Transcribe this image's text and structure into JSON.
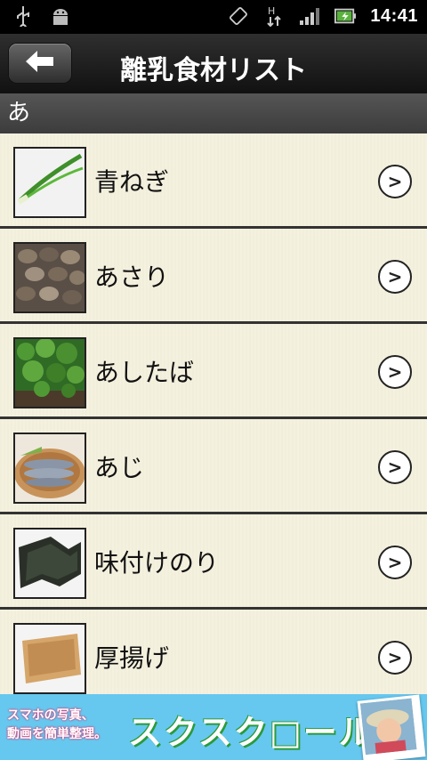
{
  "status_bar": {
    "time": "14:41",
    "icons": [
      "usb-icon",
      "android-debug-icon",
      "rotate-icon",
      "data-transfer-icon",
      "signal-icon",
      "battery-icon"
    ]
  },
  "header": {
    "title": "離乳食材リスト",
    "back_icon": "back-arrow-icon"
  },
  "section": {
    "label": "あ"
  },
  "items": [
    {
      "label": "青ねぎ",
      "icon": "green-onion-thumbnail"
    },
    {
      "label": "あさり",
      "icon": "clams-thumbnail"
    },
    {
      "label": "あしたば",
      "icon": "ashitaba-thumbnail"
    },
    {
      "label": "あじ",
      "icon": "horse-mackerel-thumbnail"
    },
    {
      "label": "味付けのり",
      "icon": "seasoned-nori-thumbnail"
    },
    {
      "label": "厚揚げ",
      "icon": "fried-tofu-thumbnail"
    }
  ],
  "chevron_symbol": ">",
  "ad": {
    "line1": "スマホの写真、",
    "line2": "動画を簡単整理。",
    "brand": "スクスク□ール"
  },
  "colors": {
    "title_bar": "#1c1c1c",
    "section_bar": "#444444",
    "list_bg": "#f5f1df",
    "ad_bg": "#66c8ef"
  }
}
